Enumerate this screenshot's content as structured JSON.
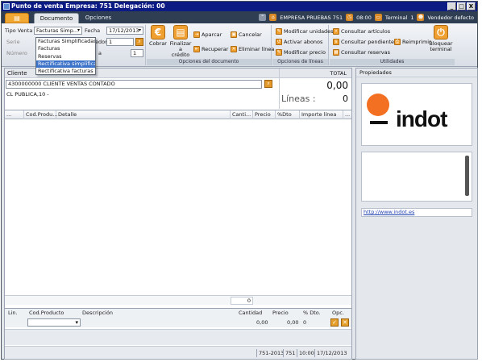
{
  "window": {
    "title": "Punto de venta Empresa: 751 Delegación: 00",
    "controls": [
      "_",
      "□",
      "X"
    ]
  },
  "tabs": {
    "file_glyph": "▤",
    "items": [
      {
        "label": "Documento",
        "active": true
      },
      {
        "label": "Opciones",
        "active": false
      }
    ]
  },
  "status_strip": {
    "company": "EMPRESA PRUEBAS 751",
    "time": "08:00",
    "terminal_label": "Terminal",
    "terminal_num": "1",
    "seller": "Vendedor defecto"
  },
  "ribbon": {
    "tipo_venta_label": "Tipo Venta",
    "tipo_venta_value": "Facturas Simp...",
    "fecha_label": "Fecha",
    "fecha_value": "17/12/2013",
    "serie_label": "Serie",
    "numero_label": "Número",
    "vendedor_label": "edor",
    "vendedor_value": "1",
    "tarifa_label": "a",
    "tarifa_value": "1",
    "cobrar_label": "Cobrar",
    "finalizar_label_1": "Finalizar",
    "finalizar_label_2": "a crédito",
    "aparcar": "Aparcar",
    "recuperar": "Recuperar",
    "cancelar": "Cancelar",
    "eliminar_linea": "Eliminar línea",
    "opciones_documento": "Opciones del documento",
    "modificar_unidades": "Modificar unidades",
    "activar_abonos": "Activar abonos",
    "modificar_precio": "Modificar precio",
    "opciones_lineas": "Opciones de líneas",
    "consultar_articulos": "Consultar artículos",
    "consultar_pendientes": "Consultar pendientes",
    "consultar_reservas": "Consultar reservas",
    "reimprimir": "Reimprimir",
    "bloquear_1": "Bloquear",
    "bloquear_2": "terminal",
    "utilidades": "Utilidades"
  },
  "tipo_venta_options": [
    {
      "label": "Facturas Simplificadas",
      "selected": false
    },
    {
      "label": "Facturas",
      "selected": false
    },
    {
      "label": "Reservas",
      "selected": false
    },
    {
      "label": "Rectificativa simplificadas",
      "selected": true
    },
    {
      "label": "Rectificativa facturas",
      "selected": false
    }
  ],
  "cliente": {
    "label": "Cliente",
    "value": "4300000000 CLIENTE VENTAS CONTADO",
    "address": "CL PUBLICA,10 -",
    "total_label": "TOTAL",
    "total_value": "0,00",
    "lineas_label": "Líneas :",
    "lineas_value": "0"
  },
  "grid": {
    "columns": [
      "...",
      "Cod.Produ...",
      "Detalle",
      "Canti...",
      "Precio",
      "%Dto",
      "Importe línea",
      "..."
    ],
    "footer_total": "0"
  },
  "entry": {
    "headers": [
      "Lin.",
      "Cod.Producto",
      "Descripción",
      "Cantidad",
      "Precio",
      "% Dto.",
      "Opc."
    ],
    "cantidad": "0,00",
    "precio": "0,00",
    "dto": "0"
  },
  "statusbar": [
    "751-2013",
    "751",
    "10:00",
    "17/12/2013"
  ],
  "side": {
    "title": "Propiedades",
    "logo_text": "indot",
    "link": "http://www.indot.es"
  }
}
